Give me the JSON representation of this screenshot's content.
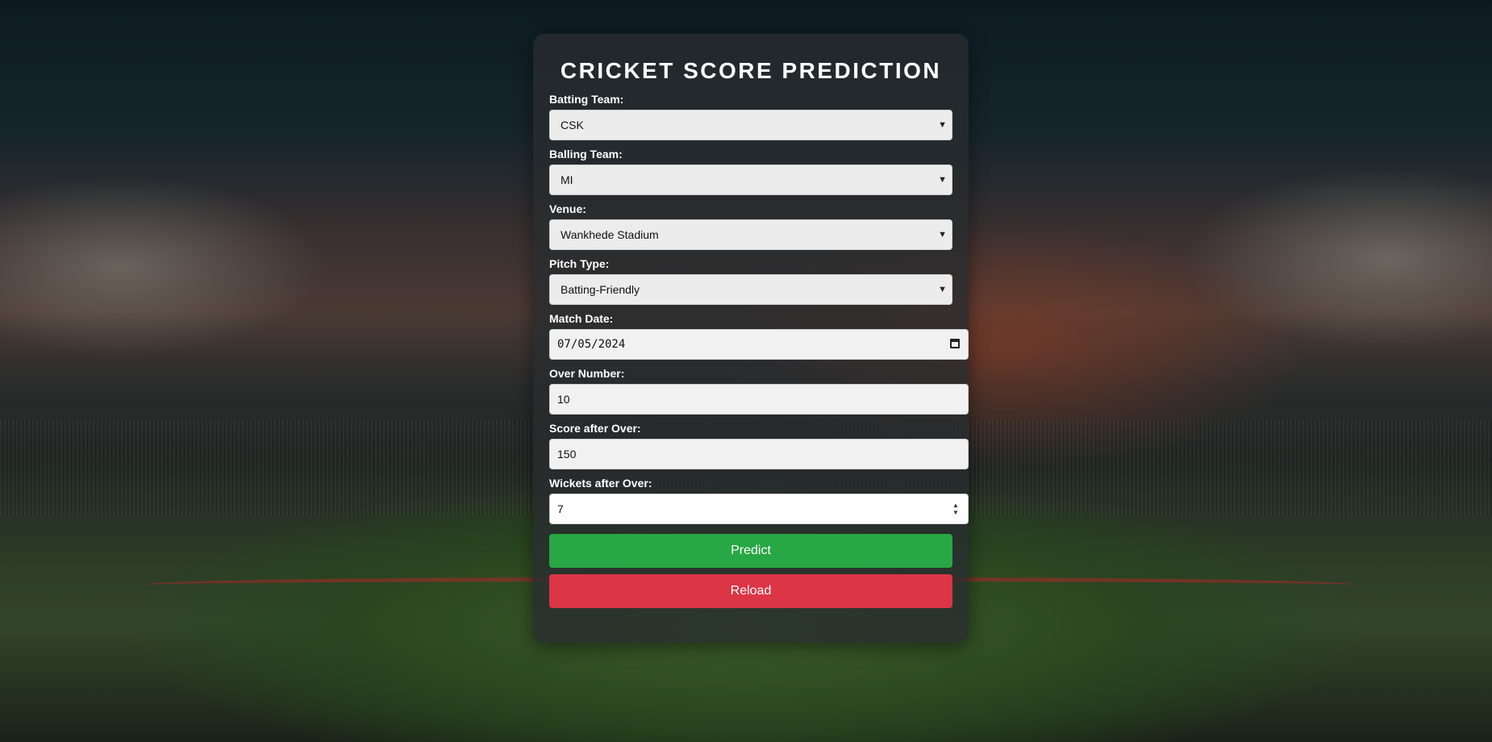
{
  "form": {
    "title": "CRICKET SCORE PREDICTION",
    "batting_team": {
      "label": "Batting Team:",
      "value": "CSK"
    },
    "balling_team": {
      "label": "Balling Team:",
      "value": "MI"
    },
    "venue": {
      "label": "Venue:",
      "value": "Wankhede Stadium"
    },
    "pitch_type": {
      "label": "Pitch Type:",
      "value": "Batting-Friendly"
    },
    "match_date": {
      "label": "Match Date:",
      "value": "07/05/2024"
    },
    "over_number": {
      "label": "Over Number:",
      "value": "10"
    },
    "score_after_over": {
      "label": "Score after Over:",
      "value": "150"
    },
    "wickets_after_over": {
      "label": "Wickets after Over:",
      "value": "7"
    },
    "predict_label": "Predict",
    "reload_label": "Reload"
  },
  "icons": {
    "select_chevron": "chevron-down-icon",
    "date_picker": "calendar-icon",
    "number_spinner": "spinner-icon"
  },
  "colors": {
    "predict_button": "#28a745",
    "reload_button": "#dc3545",
    "title_text": "#ffffff"
  }
}
